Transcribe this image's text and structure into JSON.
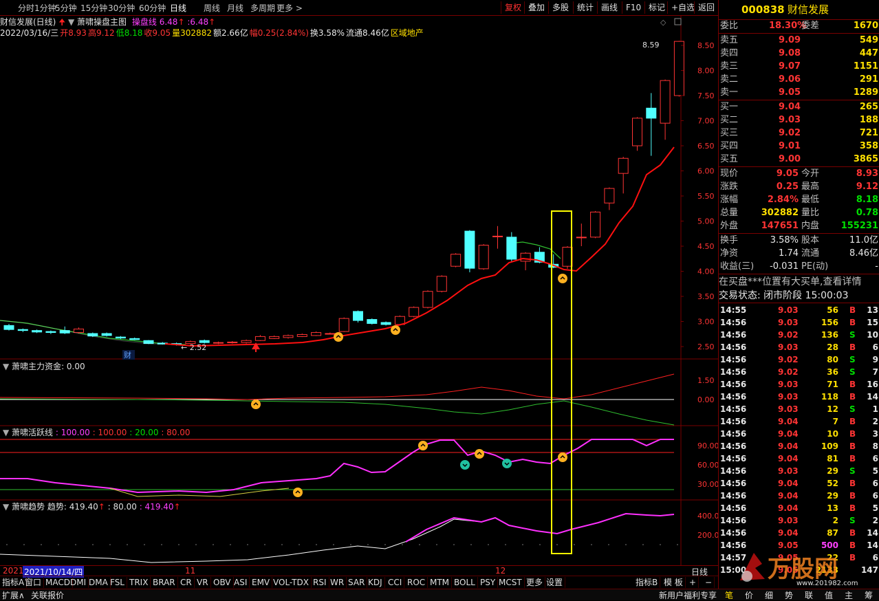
{
  "toolbar": {
    "periods": [
      "分时",
      "1分钟",
      "5分钟",
      "15分钟",
      "30分钟",
      "60分钟",
      "日线",
      "周线",
      "月线",
      "多周期",
      "更多 >"
    ],
    "active_period": "日线",
    "buttons": [
      "复权",
      "叠加",
      "多股",
      "统计",
      "画线",
      "F10",
      "标记",
      "+自选",
      "返回"
    ],
    "highlighted_buttons": [
      "复权"
    ]
  },
  "info_line1": {
    "name": "财信发展(日线)",
    "indicator": "萧啸操盘主图",
    "line_label": "操盘线",
    "value1": "6.48",
    "value2": "6.48"
  },
  "info_line2": {
    "date": "2022/03/16/三",
    "open": "开8.93",
    "high": "高9.12",
    "low": "低8.18",
    "close": "收9.05",
    "volume": "量302882",
    "amount": "额2.66亿",
    "change": "幅0.25(2.84%)",
    "turnover": "换3.58%",
    "float": "流通8.46亿",
    "sector": "区域地产"
  },
  "panels": {
    "fund": {
      "title": "萧啸主力资金",
      "value": ": 0.00"
    },
    "active": {
      "title": "萧啸活跃线",
      "v1": ": 100.00",
      "v2": ": 100.00",
      "v3": ": 20.00",
      "v4": ": 80.00"
    },
    "trend": {
      "title": "萧啸趋势",
      "label": "趋势: 419.40",
      "v2": ": 80.00",
      "v3": ": 419.40"
    }
  },
  "axis_labels": {
    "main": [
      "8.50",
      "8.00",
      "7.50",
      "7.00",
      "6.50",
      "6.00",
      "5.50",
      "5.00",
      "4.50",
      "4.00",
      "3.50",
      "3.00",
      "2.50"
    ],
    "fund": [
      "1.50",
      "0.00"
    ],
    "active": [
      "90.00",
      "60.00",
      "30.00"
    ],
    "trend": [
      "400.0",
      "200.0"
    ]
  },
  "annotations": {
    "peak_label": "8.59",
    "low_label": "2.52",
    "fin_mark": "财"
  },
  "xaxis": {
    "year": "2021",
    "date_highlight": "2021/10/14/四",
    "m11": "11",
    "m12": "12",
    "period_label": "日线"
  },
  "tabs": [
    "指标A",
    "窗口",
    "MACD",
    "DMI",
    "DMA",
    "FSL",
    "TRIX",
    "BRAR",
    "CR",
    "VR",
    "OBV",
    "ASI",
    "EMV",
    "VOL-TDX",
    "RSI",
    "WR",
    "SAR",
    "KDJ",
    "CCI",
    "ROC",
    "MTM",
    "BOLL",
    "PSY",
    "MCST",
    "更多",
    "设置"
  ],
  "tabs_right": [
    "指标B",
    "模 板",
    "+",
    "−"
  ],
  "bottombar": {
    "left1": "扩展∧",
    "left2": "关联报价",
    "right": "新用户福利专享"
  },
  "bottom_tabs": [
    "笔",
    "价",
    "细",
    "势",
    "联",
    "值",
    "主",
    "筹"
  ],
  "watermark": {
    "text": "万股网",
    "url": "www.201982.com"
  },
  "quote": {
    "code": "000838",
    "name": "财信发展",
    "weibi_label": "委比",
    "weibi": "18.30%",
    "weicha_label": "委差",
    "weicha": "1670",
    "sells": [
      {
        "label": "卖五",
        "price": "9.09",
        "vol": "549"
      },
      {
        "label": "卖四",
        "price": "9.08",
        "vol": "447"
      },
      {
        "label": "卖三",
        "price": "9.07",
        "vol": "1151"
      },
      {
        "label": "卖二",
        "price": "9.06",
        "vol": "291"
      },
      {
        "label": "卖一",
        "price": "9.05",
        "vol": "1289"
      }
    ],
    "buys": [
      {
        "label": "买一",
        "price": "9.04",
        "vol": "265"
      },
      {
        "label": "买二",
        "price": "9.03",
        "vol": "188"
      },
      {
        "label": "买三",
        "price": "9.02",
        "vol": "721"
      },
      {
        "label": "买四",
        "price": "9.01",
        "vol": "358"
      },
      {
        "label": "买五",
        "price": "9.00",
        "vol": "3865"
      }
    ],
    "stats": [
      {
        "l1": "现价",
        "v1": "9.05",
        "c1": "red",
        "l2": "今开",
        "v2": "8.93",
        "c2": "red"
      },
      {
        "l1": "涨跌",
        "v1": "0.25",
        "c1": "red",
        "l2": "最高",
        "v2": "9.12",
        "c2": "red"
      },
      {
        "l1": "涨幅",
        "v1": "2.84%",
        "c1": "red",
        "l2": "最低",
        "v2": "8.18",
        "c2": "grn"
      },
      {
        "l1": "总量",
        "v1": "302882",
        "c1": "yel",
        "l2": "量比",
        "v2": "0.78",
        "c2": "grn"
      },
      {
        "l1": "外盘",
        "v1": "147651",
        "c1": "red",
        "l2": "内盘",
        "v2": "155231",
        "c2": "grn"
      }
    ],
    "stats2": [
      {
        "l1": "换手",
        "v1": "3.58%",
        "l2": "股本",
        "v2": "11.0亿"
      },
      {
        "l1": "净资",
        "v1": "1.74",
        "l2": "流通",
        "v2": "8.46亿"
      },
      {
        "l1": "收益(三)",
        "v1": "-0.031",
        "l2": "PE(动)",
        "v2": "-"
      }
    ],
    "notice": "在买盘***位置有大买单,查看详情",
    "status": "交易状态: 闭市阶段 15:00:03"
  },
  "ticks": [
    {
      "t": "14:55",
      "p": "9.03",
      "v": "56",
      "d": "B",
      "n": "13"
    },
    {
      "t": "14:56",
      "p": "9.03",
      "v": "156",
      "d": "B",
      "n": "15"
    },
    {
      "t": "14:56",
      "p": "9.02",
      "v": "136",
      "d": "S",
      "n": "10"
    },
    {
      "t": "14:56",
      "p": "9.03",
      "v": "28",
      "d": "B",
      "n": "6"
    },
    {
      "t": "14:56",
      "p": "9.02",
      "v": "80",
      "d": "S",
      "n": "9"
    },
    {
      "t": "14:56",
      "p": "9.02",
      "v": "36",
      "d": "S",
      "n": "7"
    },
    {
      "t": "14:56",
      "p": "9.03",
      "v": "71",
      "d": "B",
      "n": "16"
    },
    {
      "t": "14:56",
      "p": "9.03",
      "v": "118",
      "d": "B",
      "n": "14"
    },
    {
      "t": "14:56",
      "p": "9.03",
      "v": "12",
      "d": "S",
      "n": "1"
    },
    {
      "t": "14:56",
      "p": "9.04",
      "v": "7",
      "d": "B",
      "n": "2"
    },
    {
      "t": "14:56",
      "p": "9.04",
      "v": "10",
      "d": "B",
      "n": "3"
    },
    {
      "t": "14:56",
      "p": "9.04",
      "v": "109",
      "d": "B",
      "n": "8"
    },
    {
      "t": "14:56",
      "p": "9.04",
      "v": "81",
      "d": "B",
      "n": "6"
    },
    {
      "t": "14:56",
      "p": "9.03",
      "v": "29",
      "d": "S",
      "n": "5"
    },
    {
      "t": "14:56",
      "p": "9.04",
      "v": "52",
      "d": "B",
      "n": "6"
    },
    {
      "t": "14:56",
      "p": "9.04",
      "v": "29",
      "d": "B",
      "n": "6"
    },
    {
      "t": "14:56",
      "p": "9.04",
      "v": "13",
      "d": "B",
      "n": "5"
    },
    {
      "t": "14:56",
      "p": "9.03",
      "v": "2",
      "d": "S",
      "n": "2"
    },
    {
      "t": "14:56",
      "p": "9.04",
      "v": "87",
      "d": "B",
      "n": "14"
    },
    {
      "t": "14:56",
      "p": "9.05",
      "v": "500",
      "d": "B",
      "n": "14"
    },
    {
      "t": "14:57",
      "p": "9.05",
      "v": "22",
      "d": "B",
      "n": "6"
    },
    {
      "t": "15:00",
      "p": "9.05",
      "v": "2133",
      "d": "",
      "n": "147"
    }
  ],
  "candles": [
    {
      "o": 2.92,
      "c": 2.84,
      "h": 2.95,
      "l": 2.82
    },
    {
      "o": 2.84,
      "c": 2.82,
      "h": 2.86,
      "l": 2.79
    },
    {
      "o": 2.82,
      "c": 2.79,
      "h": 2.84,
      "l": 2.77
    },
    {
      "o": 2.8,
      "c": 2.78,
      "h": 2.82,
      "l": 2.75
    },
    {
      "o": 2.82,
      "c": 2.77,
      "h": 2.9,
      "l": 2.75
    },
    {
      "o": 2.78,
      "c": 2.85,
      "h": 2.88,
      "l": 2.76
    },
    {
      "o": 2.76,
      "c": 2.71,
      "h": 2.78,
      "l": 2.69
    },
    {
      "o": 2.76,
      "c": 2.72,
      "h": 2.78,
      "l": 2.7
    },
    {
      "o": 2.69,
      "c": 2.67,
      "h": 2.71,
      "l": 2.65
    },
    {
      "o": 2.66,
      "c": 2.64,
      "h": 2.68,
      "l": 2.63
    },
    {
      "o": 2.62,
      "c": 2.56,
      "h": 2.63,
      "l": 2.55
    },
    {
      "o": 2.57,
      "c": 2.55,
      "h": 2.59,
      "l": 2.54
    },
    {
      "o": 2.56,
      "c": 2.54,
      "h": 2.58,
      "l": 2.52
    },
    {
      "o": 2.56,
      "c": 2.6,
      "h": 2.62,
      "l": 2.55
    },
    {
      "o": 2.62,
      "c": 2.58,
      "h": 2.64,
      "l": 2.56
    },
    {
      "o": 2.57,
      "c": 2.58,
      "h": 2.6,
      "l": 2.55
    },
    {
      "o": 2.58,
      "c": 2.59,
      "h": 2.61,
      "l": 2.56
    },
    {
      "o": 2.58,
      "c": 2.62,
      "h": 2.64,
      "l": 2.56
    },
    {
      "o": 2.62,
      "c": 2.7,
      "h": 2.73,
      "l": 2.61
    },
    {
      "o": 2.66,
      "c": 2.7,
      "h": 2.72,
      "l": 2.65
    },
    {
      "o": 2.68,
      "c": 2.72,
      "h": 2.74,
      "l": 2.66
    },
    {
      "o": 2.7,
      "c": 2.74,
      "h": 2.76,
      "l": 2.69
    },
    {
      "o": 2.72,
      "c": 2.78,
      "h": 2.8,
      "l": 2.71
    },
    {
      "o": 2.76,
      "c": 2.76,
      "h": 2.78,
      "l": 2.74
    },
    {
      "o": 2.8,
      "c": 3.06,
      "h": 3.08,
      "l": 2.79
    },
    {
      "o": 3.2,
      "c": 3.02,
      "h": 3.22,
      "l": 2.98
    },
    {
      "o": 3.04,
      "c": 2.96,
      "h": 3.06,
      "l": 2.94
    },
    {
      "o": 2.98,
      "c": 2.94,
      "h": 3.0,
      "l": 2.92
    },
    {
      "o": 2.94,
      "c": 3.1,
      "h": 3.12,
      "l": 2.92
    },
    {
      "o": 3.1,
      "c": 3.28,
      "h": 3.3,
      "l": 3.08
    },
    {
      "o": 3.28,
      "c": 3.6,
      "h": 3.62,
      "l": 3.26
    },
    {
      "o": 3.6,
      "c": 3.9,
      "h": 3.92,
      "l": 3.58
    },
    {
      "o": 4.1,
      "c": 4.34,
      "h": 4.36,
      "l": 4.08
    },
    {
      "o": 4.8,
      "c": 4.06,
      "h": 4.82,
      "l": 3.98
    },
    {
      "o": 4.05,
      "c": 4.52,
      "h": 4.54,
      "l": 4.03
    },
    {
      "o": 4.7,
      "c": 4.7,
      "h": 4.9,
      "l": 4.45
    },
    {
      "o": 4.68,
      "c": 4.24,
      "h": 4.78,
      "l": 4.2
    },
    {
      "o": 4.2,
      "c": 4.36,
      "h": 4.38,
      "l": 4.02
    },
    {
      "o": 4.38,
      "c": 4.18,
      "h": 4.48,
      "l": 4.16
    },
    {
      "o": 4.14,
      "c": 4.08,
      "h": 4.34,
      "l": 4.06
    },
    {
      "o": 4.1,
      "c": 4.48,
      "h": 4.5,
      "l": 4.05
    },
    {
      "o": 4.68,
      "c": 4.68,
      "h": 4.95,
      "l": 4.5
    },
    {
      "o": 4.68,
      "c": 5.18,
      "h": 5.2,
      "l": 4.66
    },
    {
      "o": 5.36,
      "c": 5.65,
      "h": 5.67,
      "l": 5.22
    },
    {
      "o": 5.95,
      "c": 6.25,
      "h": 6.28,
      "l": 5.55
    },
    {
      "o": 6.5,
      "c": 7.05,
      "h": 7.07,
      "l": 6.4
    },
    {
      "o": 7.25,
      "c": 7.05,
      "h": 7.55,
      "l": 6.3
    },
    {
      "o": 6.95,
      "c": 7.8,
      "h": 7.82,
      "l": 6.62
    },
    {
      "o": 7.5,
      "c": 8.58,
      "h": 8.59,
      "l": 7.48
    }
  ]
}
